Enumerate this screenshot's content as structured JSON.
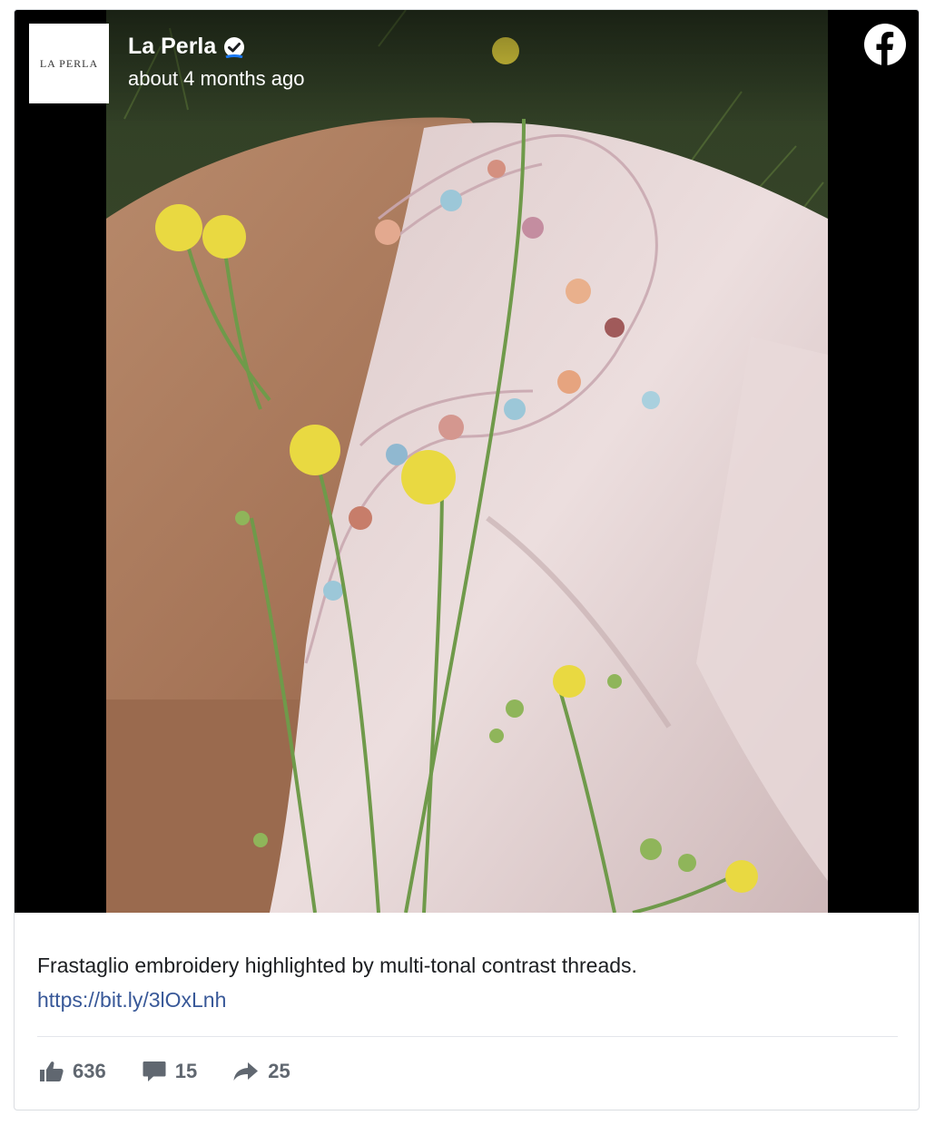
{
  "post": {
    "page_name": "La Perla",
    "avatar_text": "LA PERLA",
    "timestamp": "about 4 months ago",
    "caption": "Frastaglio embroidery highlighted by multi-tonal contrast threads.",
    "link": "https://bit.ly/3lOxLnh",
    "likes": "636",
    "comments": "15",
    "shares": "25"
  },
  "icons": {
    "verified": "verified-badge-icon",
    "facebook": "facebook-logo-icon",
    "like": "thumbs-up-icon",
    "comment": "comment-bubble-icon",
    "share": "share-arrow-icon"
  },
  "colors": {
    "link": "#385898",
    "stat_gray": "#606770",
    "text": "#1c1e21",
    "verified_blue": "#1877f2"
  }
}
